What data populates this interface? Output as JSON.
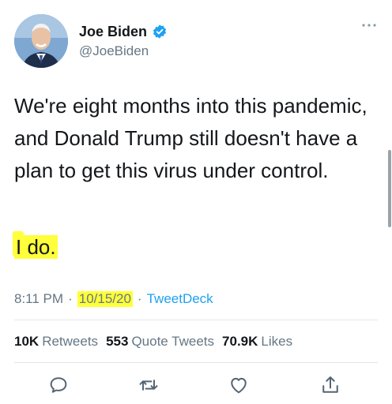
{
  "tweet": {
    "author": {
      "name": "Joe Biden",
      "handle": "@JoeBiden",
      "verified": true
    },
    "text": "We're eight months into this pandemic, and Donald Trump still doesn't have a plan to get this virus under control.",
    "text_line2": "I do.",
    "time": "8:11 PM",
    "separator": "·",
    "date": "10/15/20",
    "source": "TweetDeck",
    "stats": {
      "retweets_count": "10K",
      "retweets_label": "Retweets",
      "quote_count": "553",
      "quote_label": "Quote Tweets",
      "likes_count": "70.9K",
      "likes_label": "Likes"
    },
    "actions": [
      "reply-icon",
      "retweet-icon",
      "like-icon",
      "share-icon"
    ]
  },
  "colors": {
    "text": "#14171a",
    "muted": "#657786",
    "link": "#1da1f2",
    "highlight": "#ffff3a",
    "verified": "#1da1f2"
  }
}
